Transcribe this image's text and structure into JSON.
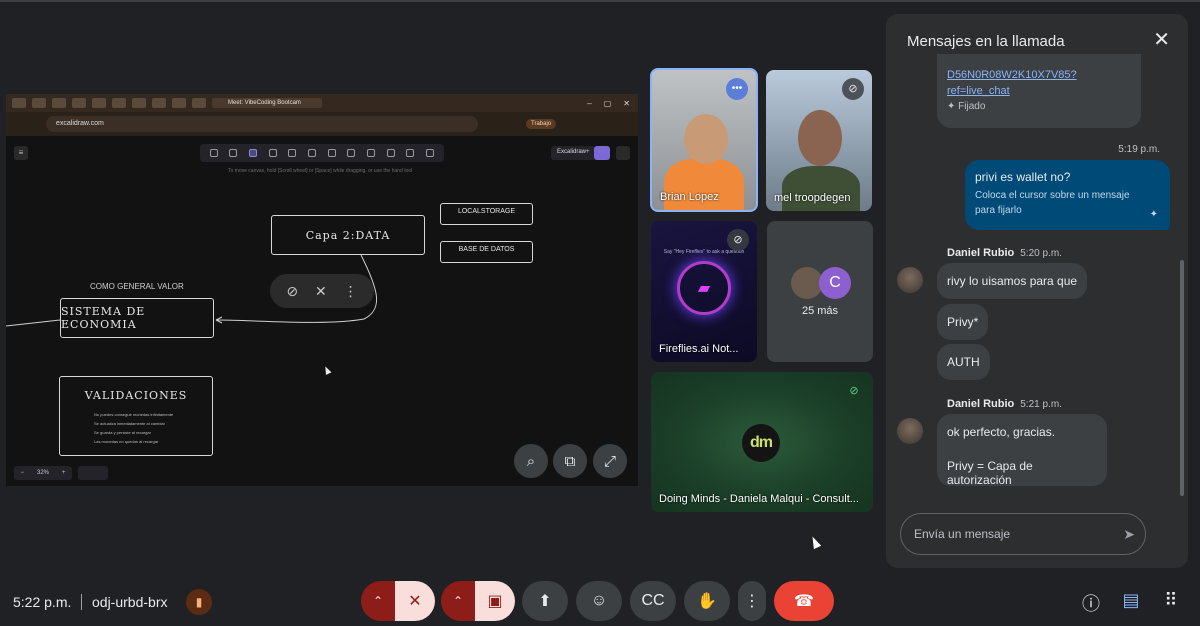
{
  "browser": {
    "tab_active": "Meet: VibeCoding Bootcam",
    "url": "excalidraw.com",
    "profile": "Trabajo",
    "window_controls": [
      "–",
      "▢",
      "✕"
    ]
  },
  "excalidraw": {
    "plus_label": "Excalidraw+",
    "hint": "To move canvas, hold [Scroll wheel] or [Space] while dragging, or use the hand tool",
    "zoom": "32%",
    "zoom_minus": "−",
    "zoom_plus": "+",
    "boxes": {
      "capa": "Capa 2:DATA",
      "localstorage": "LOCALSTORAGE",
      "base_datos": "BASE DE DATOS",
      "sistema": "SISTEMA DE ECONOMIA",
      "validaciones": "VALIDACIONES"
    },
    "general_label": "COMO GENERAL VALOR",
    "validaciones_lines": [
      "No puedes conseguir monedas infinitamente",
      "Se actualiza inmediatamente al cambiar",
      "Se guarda y persiste al recargar",
      "Las monedas no quedan al recargar"
    ],
    "pin_tools": [
      "unpin-icon",
      "mute-icon",
      "more-vert-icon"
    ]
  },
  "share_controls": [
    "zoom-in-icon",
    "pop-out-icon",
    "fullscreen-icon"
  ],
  "participants": [
    {
      "name": "Brian Lopez",
      "status": "speaking"
    },
    {
      "name": "mel troopdegen",
      "status": "muted"
    },
    {
      "name": "Fireflies.ai Not...",
      "status": "muted",
      "hint": "Say \"Hey Fireflies\" to ask a question"
    },
    {
      "name": "25 más",
      "avatar_letter": "C"
    },
    {
      "name": "Doing Minds - Daniela Malqui - Consult...",
      "status": "muted",
      "logo": "dm"
    }
  ],
  "chat": {
    "title": "Mensajes en la llamada",
    "pinned": {
      "link_line1": "D56N0R08W2K10X7V85?",
      "link_line2": "ref=live_chat",
      "pinned_label": "Fijado"
    },
    "own_time": "5:19 p.m.",
    "own_message": "privi es wallet no?",
    "own_hint": "Coloca el cursor sobre un mensaje para fijarlo",
    "groups": [
      {
        "sender": "Daniel Rubio",
        "time": "5:20 p.m.",
        "messages": [
          "rivy lo uisamos para que",
          "Privy*",
          "AUTH"
        ]
      },
      {
        "sender": "Daniel Rubio",
        "time": "5:21 p.m.",
        "messages": [
          "ok perfecto, gracias.",
          "Privy = Capa de autorización"
        ]
      }
    ],
    "input_placeholder": "Envía un mensaje"
  },
  "bottom": {
    "time": "5:22 p.m.",
    "meeting_code": "odj-urbd-brx"
  },
  "colors": {
    "background": "#202124",
    "hangup": "#ea4335",
    "accent": "#8ab4f8"
  }
}
